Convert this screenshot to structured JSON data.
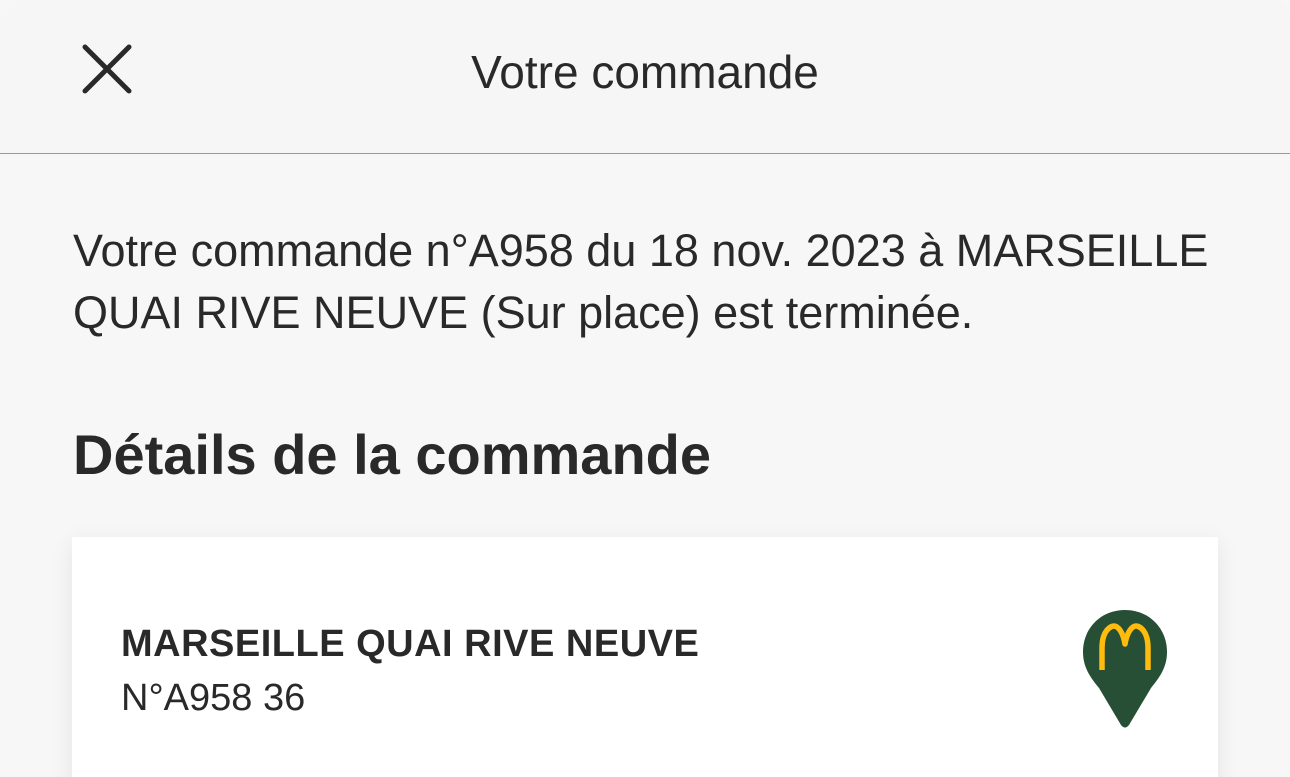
{
  "header": {
    "title": "Votre commande",
    "close_icon": "close-icon"
  },
  "status": {
    "message": "Votre commande n°A958 du 18 nov. 2023 à MARSEILLE QUAI RIVE NEUVE (Sur place) est terminée."
  },
  "details": {
    "section_title": "Détails de la commande",
    "card": {
      "restaurant_name": "MARSEILLE QUAI RIVE NEUVE",
      "order_number": "N°A958 36",
      "location_icon": "mcdonalds-location-pin-icon"
    }
  },
  "colors": {
    "background": "#f7f7f7",
    "text": "#292929",
    "pin_green": "#264f36",
    "arches_yellow": "#ffbc0d",
    "card": "#ffffff"
  }
}
